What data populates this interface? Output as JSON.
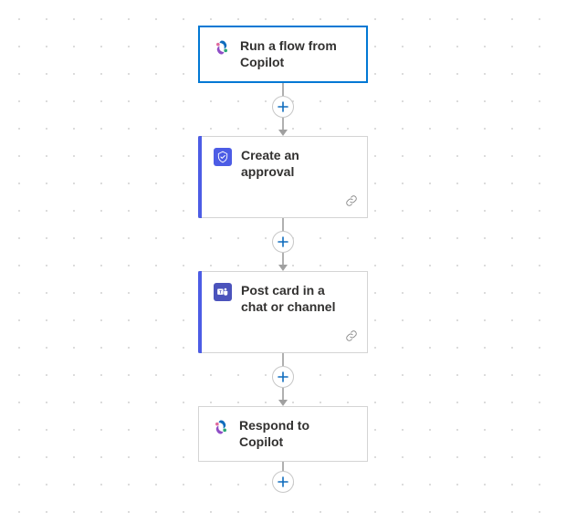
{
  "flow": {
    "nodes": [
      {
        "id": "trigger",
        "label": "Run a flow from Copilot",
        "icon": "copilot"
      },
      {
        "id": "approval",
        "label": "Create an approval",
        "icon": "approval"
      },
      {
        "id": "teams",
        "label": "Post card in a chat or channel",
        "icon": "teams"
      },
      {
        "id": "respond",
        "label": "Respond to Copilot",
        "icon": "copilot"
      }
    ]
  }
}
